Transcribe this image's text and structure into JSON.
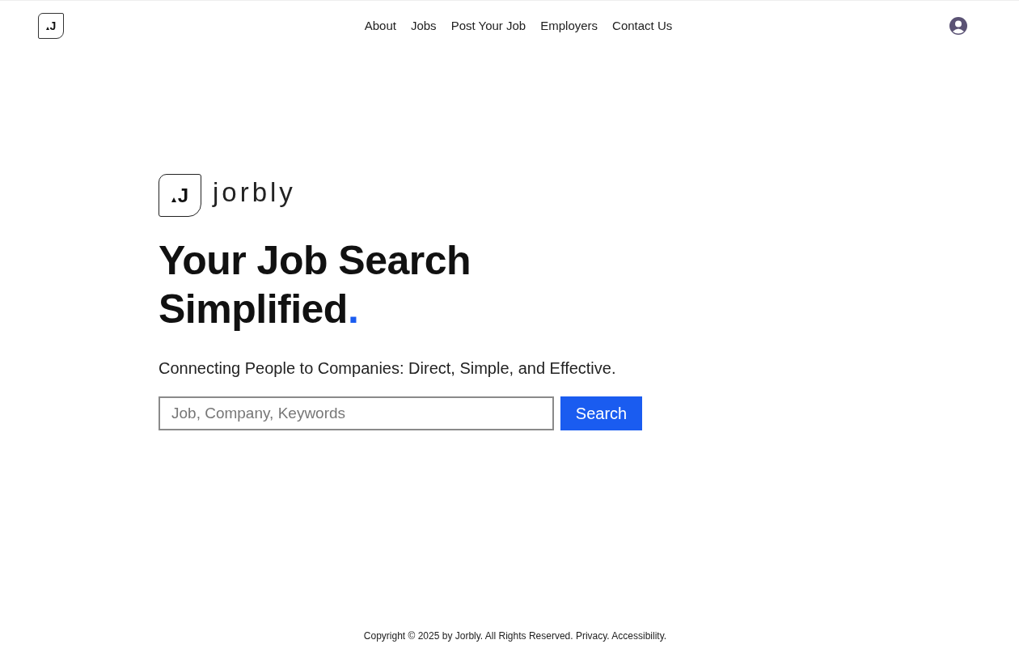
{
  "header": {
    "logo_letter": "J",
    "nav": [
      {
        "label": "About"
      },
      {
        "label": "Jobs"
      },
      {
        "label": "Post Your Job"
      },
      {
        "label": "Employers"
      },
      {
        "label": "Contact Us"
      }
    ]
  },
  "hero": {
    "logo_letter": "J",
    "wordmark": "jorbly",
    "headline_lines": [
      "Your Job Search",
      "Simplified"
    ],
    "accent": ".",
    "subtitle": "Connecting People to Companies: Direct, Simple, and Effective.",
    "search": {
      "placeholder": "Job, Company, Keywords",
      "button": "Search"
    }
  },
  "footer": {
    "text": "Copyright © 2025 by Jorbly. All Rights Reserved. Privacy. Accessibility."
  }
}
